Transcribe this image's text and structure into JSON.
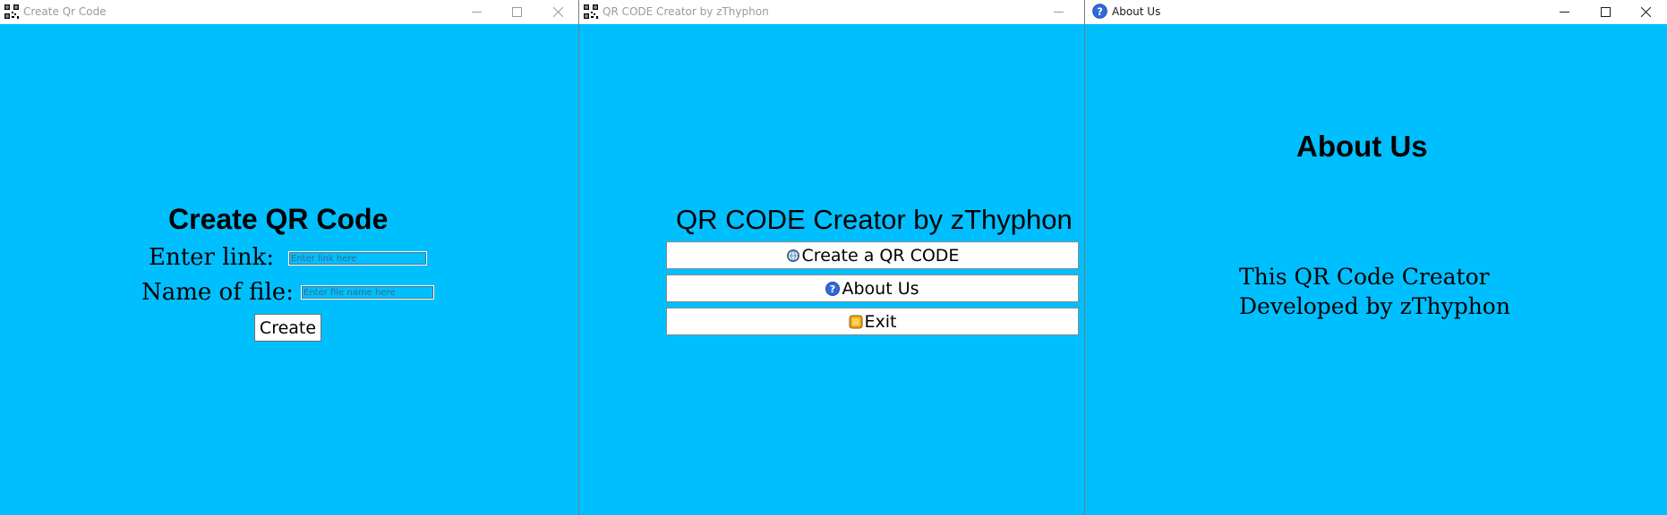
{
  "windows": [
    {
      "title": "Create Qr Code",
      "heading": "Create QR Code",
      "link_label": "Enter link:",
      "link_placeholder": "Enter link here",
      "file_label": "Name of file:",
      "file_placeholder": "Enter file name here",
      "create_button": "Create"
    },
    {
      "title": "QR CODE Creator by zThyphon",
      "heading": "QR CODE Creator by zThyphon",
      "buttons": [
        {
          "label": "Create a QR CODE",
          "icon": "qr-globe-icon"
        },
        {
          "label": "About Us",
          "icon": "help-icon"
        },
        {
          "label": "Exit",
          "icon": "exit-icon"
        }
      ]
    },
    {
      "title": "About Us",
      "heading": "About Us",
      "text_line1": "This QR Code Creator",
      "text_line2": "Developed by zThyphon"
    }
  ],
  "colors": {
    "background": "#00bfff",
    "titlebar": "#ffffff",
    "help_icon": "#2f6ad9",
    "exit_icon": "#f0a81a"
  }
}
